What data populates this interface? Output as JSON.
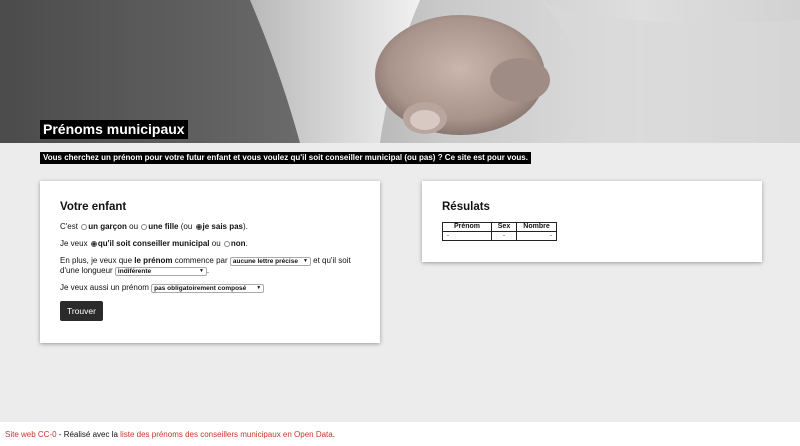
{
  "header": {
    "site_title": "Prénoms municipaux",
    "tagline": "Vous cherchez un prénom pour votre futur enfant et vous voulez qu'il soit conseiller municipal (ou pas) ? Ce site est pour vous."
  },
  "form": {
    "title": "Votre enfant",
    "gender": {
      "prefix": "C'est",
      "options": [
        "un garçon",
        "une fille",
        "je sais pas"
      ],
      "sep_ou": "ou",
      "sep_paren_ou": "(ou",
      "suffix": ").",
      "selected": "je sais pas"
    },
    "council": {
      "prefix": "Je veux",
      "option_yes": "qu'il soit conseiller municipal",
      "sep": "ou",
      "option_no": "non",
      "suffix": ".",
      "selected": "qu'il soit conseiller municipal"
    },
    "letter": {
      "prefix": "En plus, je veux que",
      "bold": "le prénom",
      "middle": "commence par",
      "value": "aucune lettre précise",
      "after": "et qu'il soit d'une longueur",
      "length_value": "indiférente",
      "suffix": "."
    },
    "compose": {
      "prefix": "Je veux aussi un prénom",
      "value": "pas obligatoirement composé"
    },
    "submit_label": "Trouver"
  },
  "results": {
    "title": "Résulats",
    "columns": [
      "Prénom",
      "Sex",
      "Nombre"
    ],
    "rows": [
      [
        "-",
        "-",
        "-"
      ]
    ]
  },
  "footer": {
    "link1": "Site web CC-0",
    "text": " - Réalisé avec la ",
    "link2": "liste des prénoms des conseillers municipaux en Open Data",
    "end": "."
  }
}
